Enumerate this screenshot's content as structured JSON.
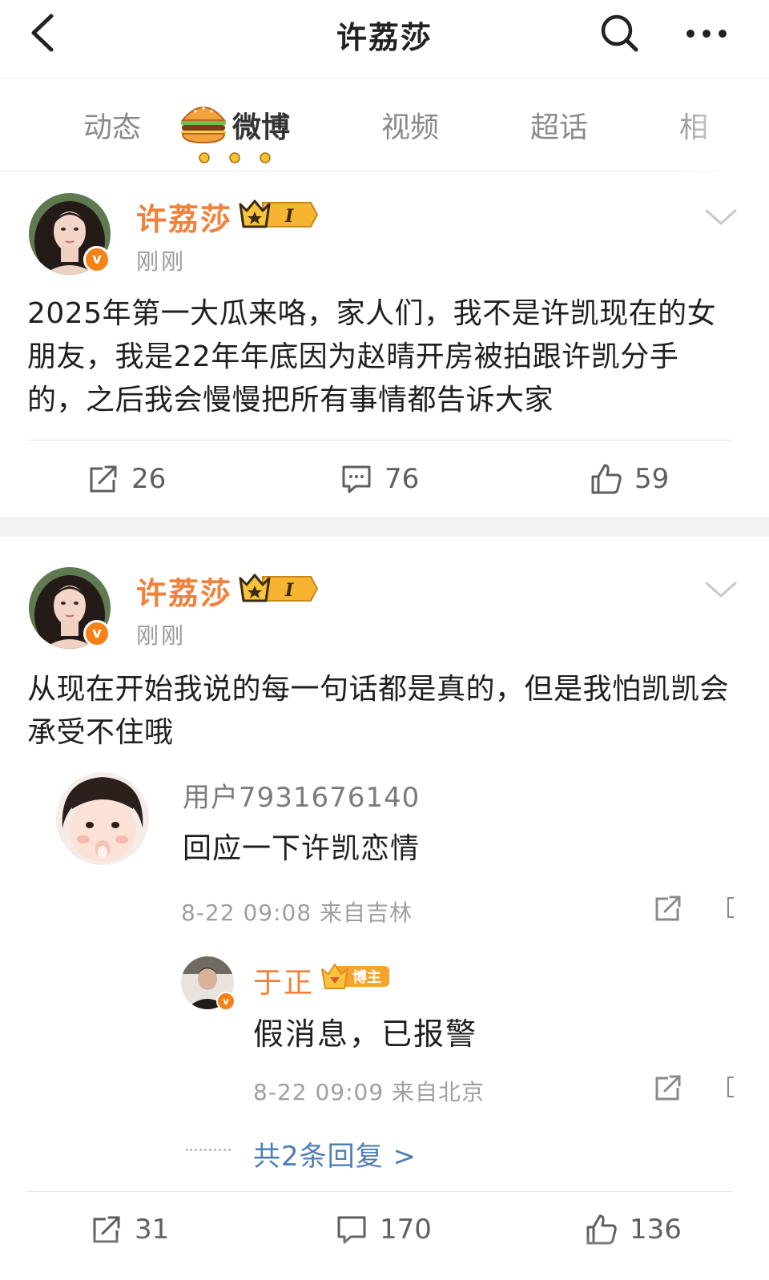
{
  "header": {
    "title": "许荔莎",
    "back_icon": "chevron-left-icon",
    "search_icon": "search-icon",
    "more_icon": "more-horizontal-icon"
  },
  "tabs": [
    {
      "label": "动态",
      "active": false
    },
    {
      "label": "微博",
      "active": true
    },
    {
      "label": "视频",
      "active": false
    },
    {
      "label": "超话",
      "active": false
    },
    {
      "label": "相",
      "active": false
    }
  ],
  "posts": [
    {
      "author": "许荔莎",
      "time": "刚刚",
      "badge_text": "I",
      "text": "2025年第一大瓜来咯，家人们，我不是许凯现在的女朋友，我是22年年底因为赵晴开房被拍跟许凯分手的，之后我会慢慢把所有事情都告诉大家",
      "reposts": "26",
      "comments": "76",
      "likes": "59"
    },
    {
      "author": "许荔莎",
      "time": "刚刚",
      "badge_text": "I",
      "text": "从现在开始我说的每一句话都是真的，但是我怕凯凯会承受不住哦",
      "quoted_comment": {
        "user": "用户7931676140",
        "text": "回应一下许凯恋情",
        "meta": "8-22 09:08 来自吉林",
        "reply": {
          "user": "于正",
          "badge": "博主",
          "text": "假消息，已报警",
          "meta": "8-22 09:09 来自北京"
        },
        "more_replies": "共2条回复 >"
      },
      "reposts": "31",
      "comments": "170",
      "likes": "136"
    }
  ],
  "colors": {
    "accent_orange": "#f1803a",
    "verified_orange": "#f78119",
    "link_blue": "#4e7fb5",
    "gray_text": "#9a9a9a"
  }
}
